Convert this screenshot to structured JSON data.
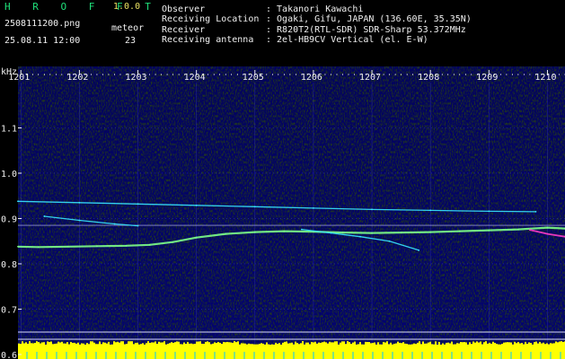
{
  "header": {
    "app_name": "H R O F F T",
    "version": "1.0.0",
    "filename": "2508111200.png",
    "datetime": "25.08.11 12:00",
    "count_label": "meteor",
    "count_value": "23",
    "fields": [
      {
        "label": "Observer",
        "value": ": Takanori Kawachi"
      },
      {
        "label": "Receiving Location",
        "value": ": Ogaki, Gifu, JAPAN (136.60E, 35.35N)"
      },
      {
        "label": "Receiver",
        "value": ": R820T2(RTL-SDR) SDR-Sharp 53.372MHz"
      },
      {
        "label": "Receiving antenna",
        "value": ": 2el-HB9CV Vertical (el. E-W)"
      }
    ]
  },
  "colors": {
    "background": "#000000",
    "plot_noise_dark": "#00008a",
    "plot_noise_light": "#2a3cff",
    "trace_cyan": "#37e8ff",
    "trace_green": "#7dff88",
    "trace_magenta": "#ff3cc8",
    "bottom_band": "#ffff00",
    "grid_line": "#c8c8ff",
    "text": "#f0f0f0"
  },
  "chart_data": {
    "type": "heatmap",
    "title": "",
    "xlabel": "",
    "ylabel": "kHz",
    "x_ticks": [
      "1201",
      "1202",
      "1203",
      "1204",
      "1205",
      "1206",
      "1207",
      "1208",
      "1209",
      "1210"
    ],
    "y_ticks": [
      "1.1",
      "1.0",
      "0.9",
      "0.8",
      "0.7",
      "0.6"
    ],
    "ylim": [
      0.59,
      1.2
    ],
    "xlim": [
      1200.95,
      1210.3
    ],
    "grid": true,
    "series": [
      {
        "name": "",
        "style": "bright-green",
        "x": [
          1200.95,
          1201.3,
          1201.8,
          1202.3,
          1202.8,
          1203.2,
          1203.6,
          1204.0,
          1204.5,
          1205.0,
          1205.5,
          1206.0,
          1206.5,
          1207.0,
          1207.5,
          1208.0,
          1208.5,
          1209.0,
          1209.5,
          1210.0,
          1210.3
        ],
        "y": [
          0.838,
          0.837,
          0.838,
          0.839,
          0.84,
          0.842,
          0.848,
          0.858,
          0.866,
          0.87,
          0.872,
          0.871,
          0.869,
          0.868,
          0.869,
          0.87,
          0.872,
          0.874,
          0.876,
          0.88,
          0.878
        ]
      },
      {
        "name": "",
        "style": "cyan",
        "x": [
          1200.95,
          1202.0,
          1203.0,
          1204.0,
          1205.0,
          1206.0,
          1207.0,
          1208.0,
          1209.0,
          1209.8
        ],
        "y": [
          0.938,
          0.935,
          0.932,
          0.929,
          0.926,
          0.923,
          0.92,
          0.918,
          0.916,
          0.915
        ]
      },
      {
        "name": "",
        "style": "cyan",
        "x": [
          1201.4,
          1202.0,
          1202.6,
          1203.0
        ],
        "y": [
          0.905,
          0.896,
          0.888,
          0.884
        ]
      },
      {
        "name": "",
        "style": "cyan",
        "x": [
          1205.8,
          1206.3,
          1206.8,
          1207.3,
          1207.8
        ],
        "y": [
          0.876,
          0.868,
          0.86,
          0.85,
          0.83
        ]
      },
      {
        "name": "",
        "style": "magenta",
        "x": [
          1209.7,
          1210.0,
          1210.3
        ],
        "y": [
          0.875,
          0.866,
          0.86
        ]
      }
    ]
  }
}
